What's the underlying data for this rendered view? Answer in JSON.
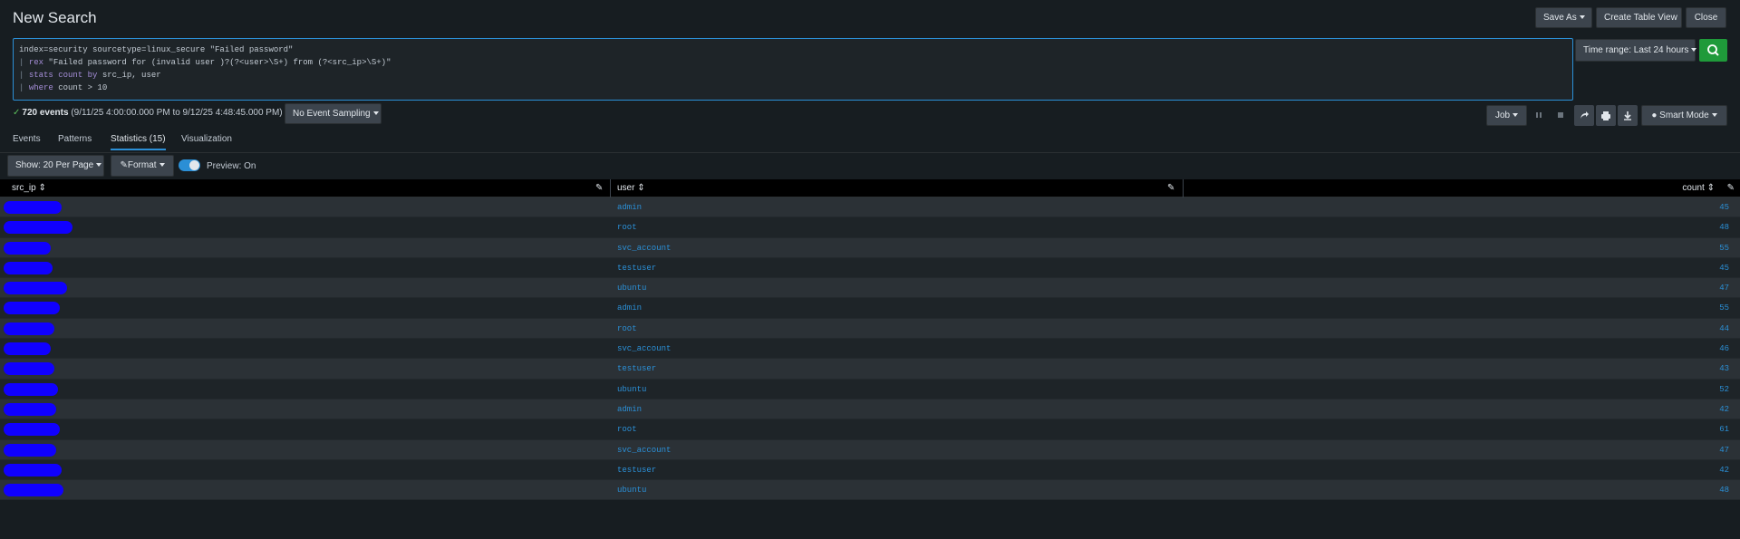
{
  "header": {
    "title": "New Search",
    "save_as_label": "Save As",
    "create_table_view_label": "Create Table View",
    "close_label": "Close"
  },
  "search": {
    "lines": [
      {
        "kw": "",
        "text": "index=security sourcetype=linux_secure \"Failed password\""
      },
      {
        "kw": "rex",
        "text": " \"Failed password for (invalid user )?(?<user>\\S+) from (?<src_ip>\\S+)\""
      },
      {
        "kw": "stats count by",
        "text": " src_ip, user"
      },
      {
        "kw": "where",
        "text": " count > 10"
      }
    ],
    "time_range_label": "Time range: Last 24 hours",
    "search_button_icon": "search-icon"
  },
  "status": {
    "events_count": "720 events",
    "events_range": "(9/11/25 4:00:00.000 PM to 9/12/25 4:48:45.000 PM)",
    "sampling_label": "No Event Sampling",
    "job_label": "Job",
    "smart_mode_label": "Smart Mode"
  },
  "tabs": [
    {
      "label": "Events"
    },
    {
      "label": "Patterns"
    },
    {
      "label": "Statistics (15)"
    },
    {
      "label": "Visualization"
    }
  ],
  "toolbar": {
    "show_per_page_label": "Show: 20 Per Page",
    "format_label": "Format",
    "preview_label": "Preview: On"
  },
  "table": {
    "columns": [
      "src_ip",
      "user",
      "count"
    ],
    "rows": [
      {
        "user": "admin",
        "count": "45"
      },
      {
        "user": "root",
        "count": "48"
      },
      {
        "user": "svc_account",
        "count": "55"
      },
      {
        "user": "testuser",
        "count": "45"
      },
      {
        "user": "ubuntu",
        "count": "47"
      },
      {
        "user": "admin",
        "count": "55"
      },
      {
        "user": "root",
        "count": "44"
      },
      {
        "user": "svc_account",
        "count": "46"
      },
      {
        "user": "testuser",
        "count": "43"
      },
      {
        "user": "ubuntu",
        "count": "52"
      },
      {
        "user": "admin",
        "count": "42"
      },
      {
        "user": "root",
        "count": "61"
      },
      {
        "user": "svc_account",
        "count": "47"
      },
      {
        "user": "testuser",
        "count": "42"
      },
      {
        "user": "ubuntu",
        "count": "48"
      }
    ]
  },
  "colors": {
    "accent": "#2b8fd6",
    "search_green": "#1f9a3a",
    "redaction": "#1000ff"
  }
}
